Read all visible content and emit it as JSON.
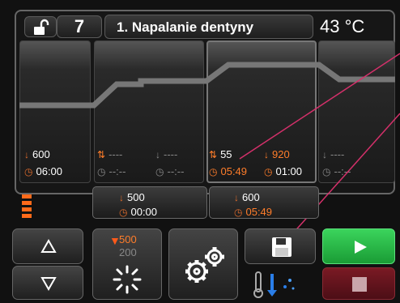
{
  "header": {
    "program_number": "7",
    "program_name": "1. Napalanie dentyny",
    "chamber_temp": "43 °C"
  },
  "segments": [
    {
      "temp": "600",
      "time": "06:00"
    },
    {
      "rate": "----",
      "rate_time": "--:--",
      "hold": "----",
      "hold_time": "--:--"
    },
    {
      "rate": "55",
      "rate_time": "05:49",
      "hold": "920",
      "hold_time": "01:00"
    },
    {
      "hold": "----",
      "hold_time": "--:--"
    }
  ],
  "transitions": [
    {
      "temp": "500",
      "time": "00:00"
    },
    {
      "temp": "600",
      "time": "05:49"
    }
  ],
  "controls": {
    "temp_hi": "500",
    "temp_lo": "200"
  },
  "icons": {
    "lock": "unlock-icon",
    "up": "arrow-up-icon",
    "down": "arrow-down-icon",
    "save": "floppy-disk-icon",
    "settings": "gears-icon",
    "start": "play-icon",
    "stop": "stop-icon",
    "vacuum": "thermometer-cooling-icon"
  },
  "colors": {
    "accent_orange": "#ff7d2a",
    "start_green": "#2cc04a",
    "stop_red": "#6a1420"
  }
}
